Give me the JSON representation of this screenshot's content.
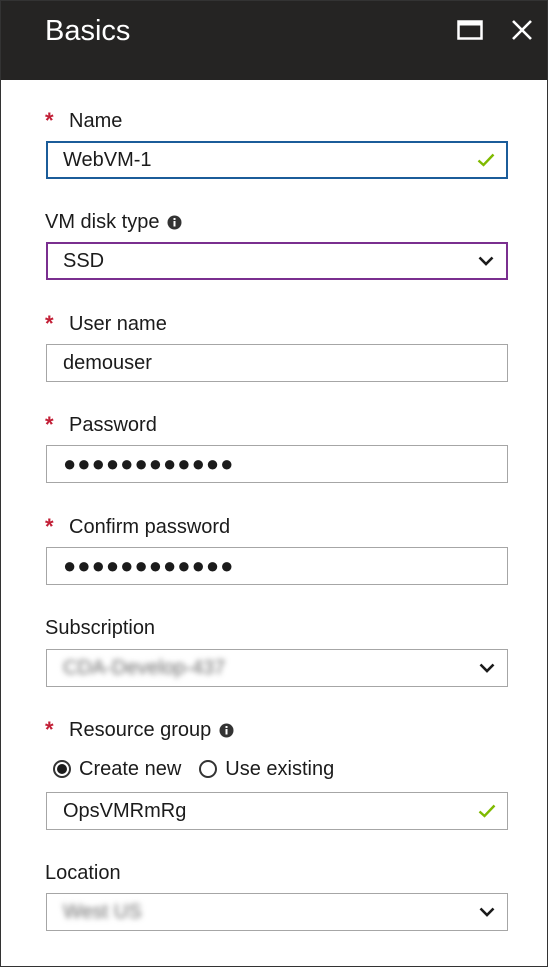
{
  "blade": {
    "title": "Basics",
    "maximize_icon": "maximize-icon",
    "close_icon": "close-icon"
  },
  "form": {
    "name": {
      "label": "Name",
      "required": true,
      "value": "WebVM-1",
      "valid": true
    },
    "disk_type": {
      "label": "VM disk type",
      "value": "SSD",
      "info_icon": "info-icon"
    },
    "user_name": {
      "label": "User name",
      "required": true,
      "value": "demouser"
    },
    "password": {
      "label": "Password",
      "required": true,
      "value": "●●●●●●●●●●●●"
    },
    "confirm_password": {
      "label": "Confirm password",
      "required": true,
      "value": "●●●●●●●●●●●●"
    },
    "subscription": {
      "label": "Subscription",
      "value": "CDA-Develop-437",
      "blurred": true
    },
    "resource_group": {
      "label": "Resource group",
      "required": true,
      "info_icon": "info-icon",
      "options": [
        "Create new",
        "Use existing"
      ],
      "selected": "Create new",
      "value": "OpsVMRmRg",
      "valid": true
    },
    "location": {
      "label": "Location",
      "value": "West US",
      "blurred": true
    }
  },
  "colors": {
    "header_bg": "#252423",
    "required_star": "#c21f36",
    "valid_check": "#7fba00",
    "focus_border": "#1b5c99",
    "select_border": "#7a2f8f"
  },
  "required_mark": "*"
}
